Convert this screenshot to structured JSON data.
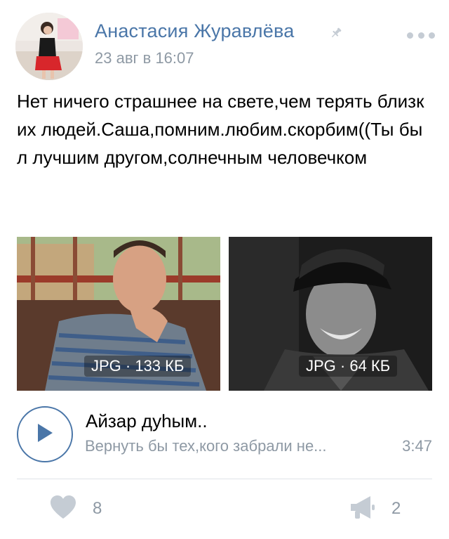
{
  "post": {
    "author": "Анастасия Журавлёва",
    "date": "23 авг в 16:07",
    "text": "Нет ничего страшнее на свете,чем терять близких людей.Саша,помним.любим.скорбим((Ты был лучшим другом,солнечным человечком",
    "icons": {
      "pin": "pin-icon",
      "more": "more-dots-icon"
    }
  },
  "attachments": {
    "photos": [
      {
        "badge": "JPG · 133 КБ"
      },
      {
        "badge": "JPG · 64 КБ"
      }
    ]
  },
  "audio": {
    "title": "Айзар дуһым..",
    "subtitle": "Вернуть бы тех,кого забрали не...",
    "duration": "3:47"
  },
  "footer": {
    "likes": "8",
    "reposts": "2"
  },
  "colors": {
    "accent": "#4a76a8",
    "muted": "#8e99a4",
    "divider": "#dfe3e8"
  }
}
